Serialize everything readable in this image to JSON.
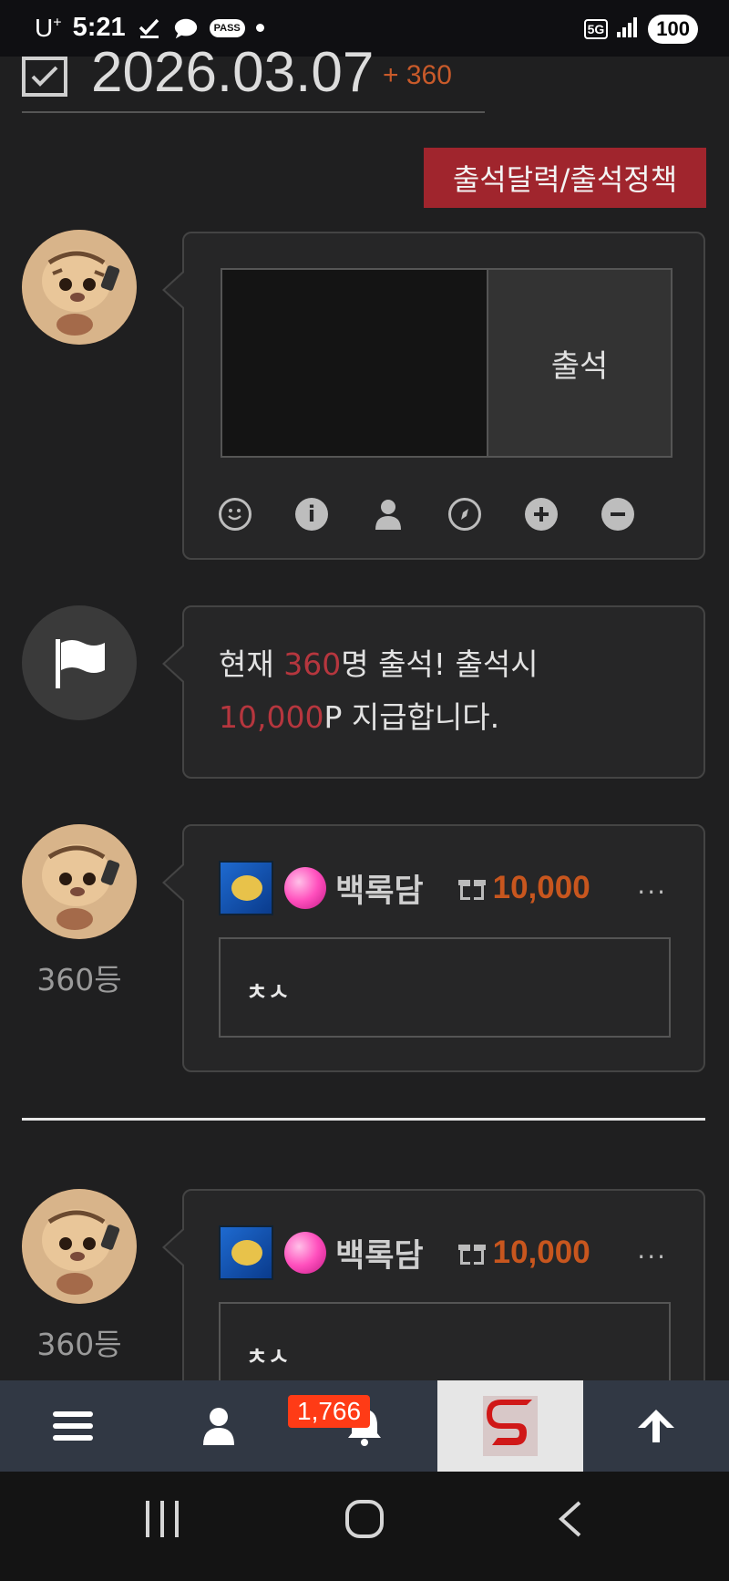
{
  "status_bar": {
    "carrier": "U",
    "carrier_sup": "+",
    "time": "5:21",
    "pass_label": "PASS",
    "network": "5G",
    "battery": "100"
  },
  "header": {
    "date": "2026.03.07",
    "increment": "+ 360"
  },
  "policy_button": "출석달력/출석정책",
  "attendance": {
    "submit_label": "출석",
    "tools": [
      "smile-icon",
      "info-icon",
      "user-icon",
      "compass-icon",
      "plus-icon",
      "minus-icon"
    ]
  },
  "notice": {
    "prefix": "현재 ",
    "count": "360",
    "middle": "명 출석! 출석시",
    "points": "10,000",
    "suffix": "P 지급합니다."
  },
  "comments": [
    {
      "rank": "360등",
      "name": "백록담",
      "points": "10,000",
      "more": "···",
      "body": "ㅊㅅ"
    },
    {
      "rank": "360등",
      "name": "백록담",
      "points": "10,000",
      "more": "···",
      "body": "ㅊㅅ"
    }
  ],
  "bottom_nav": {
    "notification_count": "1,766",
    "items": [
      "menu-icon",
      "user-icon",
      "bell-icon",
      "site-logo",
      "arrow-up-icon"
    ]
  },
  "colors": {
    "accent_red": "#a0252d",
    "points_orange": "#c8561e",
    "badge_red": "#ff3b16"
  }
}
